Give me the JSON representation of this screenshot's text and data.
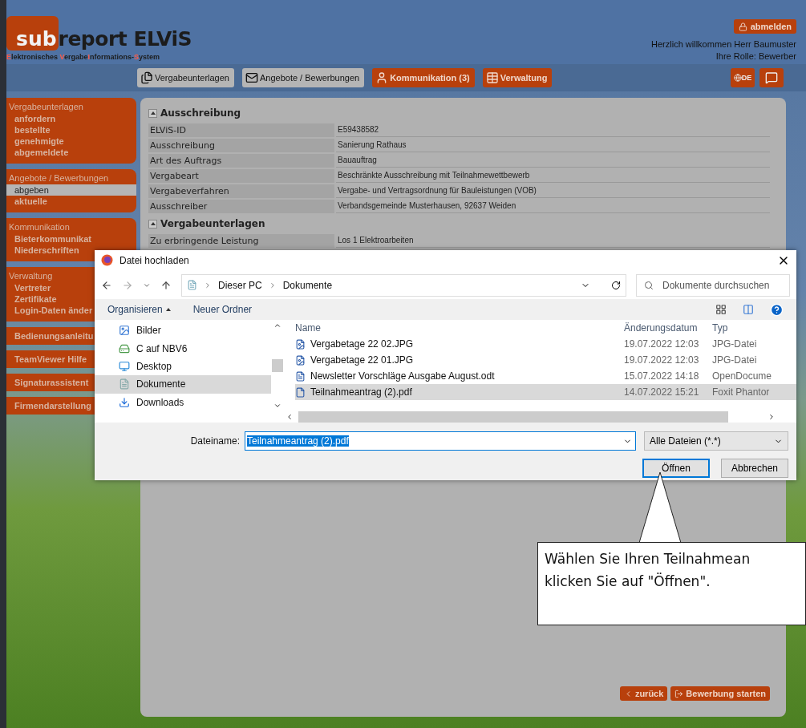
{
  "header": {
    "logo": {
      "part_1": "sub",
      "part_2": "report ELViS"
    },
    "subtitle": [
      {
        "text": "E",
        "accent": true
      },
      {
        "text": "lektronisches ",
        "accent": false
      },
      {
        "text": "V",
        "accent": true
      },
      {
        "text": "ergabe",
        "accent": false
      },
      {
        "text": "I",
        "accent": true
      },
      {
        "text": "nformations-",
        "accent": false
      },
      {
        "text": "S",
        "accent": true
      },
      {
        "text": "ystem",
        "accent": false
      }
    ],
    "logout": "abmelden",
    "welcome": "Herzlich willkommen Herr Baumuster",
    "role": "Ihre Rolle: Bewerber"
  },
  "nav": {
    "tabs": [
      {
        "label": "Vergabeunterlagen",
        "selected": true
      },
      {
        "label": "Angebote / Bewerbungen",
        "selected": true
      },
      {
        "label": "Kommunikation (3)",
        "selected": false
      },
      {
        "label": "Verwaltung",
        "selected": false
      }
    ],
    "language": "DE"
  },
  "sidebar": [
    {
      "title": "Vergabeunterlagen",
      "items": [
        {
          "label": "anfordern",
          "selected": false
        },
        {
          "label": "bestellte",
          "selected": false
        },
        {
          "label": "genehmigte",
          "selected": false
        },
        {
          "label": "abgemeldete",
          "selected": false
        }
      ]
    },
    {
      "title": "Angebote / Bewerbungen",
      "items": [
        {
          "label": "abgeben",
          "selected": true
        },
        {
          "label": "aktuelle",
          "selected": false
        }
      ]
    },
    {
      "title": "Kommunikation",
      "items": [
        {
          "label": "Bieterkommunikat",
          "selected": false
        },
        {
          "label": "Niederschriften",
          "selected": false
        }
      ]
    },
    {
      "title": "Verwaltung",
      "items": [
        {
          "label": "Vertreter",
          "selected": false
        },
        {
          "label": "Zertifikate",
          "selected": false
        },
        {
          "label": "Login-Daten änder",
          "selected": false
        }
      ]
    },
    {
      "title": "Bedienungsanleitu"
    },
    {
      "title": "TeamViewer Hilfe"
    },
    {
      "title": "Signaturassistent"
    },
    {
      "title": "Firmendarstellung"
    }
  ],
  "main": {
    "sections": [
      {
        "title": "Ausschreibung",
        "rows": [
          {
            "label": "ELViS-ID",
            "value": "E59438582"
          },
          {
            "label": "Ausschreibung",
            "value": "Sanierung Rathaus"
          },
          {
            "label": "Art des Auftrags",
            "value": "Bauauftrag"
          },
          {
            "label": "Vergabeart",
            "value": "Beschränkte Ausschreibung mit Teilnahmewettbewerb"
          },
          {
            "label": "Vergabeverfahren",
            "value": "Vergabe- und Vertragsordnung für Bauleistungen (VOB)"
          },
          {
            "label": "Ausschreiber",
            "value": "Verbandsgemeinde Musterhausen, 92637 Weiden"
          }
        ]
      },
      {
        "title": "Vergabeunterlagen",
        "rows": [
          {
            "label": "Zu erbringende Leistung",
            "value": "Los 1 Elektroarbeiten"
          }
        ]
      }
    ],
    "buttons": [
      {
        "kind": "back",
        "label": "zurück"
      },
      {
        "kind": "start",
        "label": "Bewerbung starten"
      }
    ]
  },
  "dialog": {
    "title": "Datei hochladen",
    "path": [
      "Dieser PC",
      "Dokumente"
    ],
    "search": {
      "placeholder": "Dokumente durchsuchen"
    },
    "toolbar": {
      "organize": "Organisieren",
      "new_folder": "Neuer Ordner"
    },
    "tree": [
      {
        "kind": "pictures",
        "label": "Bilder",
        "selected": false
      },
      {
        "kind": "drive",
        "label": "C auf NBV6",
        "selected": false
      },
      {
        "kind": "desktop",
        "label": "Desktop",
        "selected": false
      },
      {
        "kind": "documents",
        "label": "Dokumente",
        "selected": true
      },
      {
        "kind": "downloads",
        "label": "Downloads",
        "selected": false
      }
    ],
    "columns": [
      "Name",
      "Änderungsdatum",
      "Typ"
    ],
    "files": [
      {
        "kind": "image",
        "name": "Vergabetage 22 02.JPG",
        "date": "19.07.2022 12:03",
        "type": "JPG-Datei",
        "selected": false
      },
      {
        "kind": "image",
        "name": "Vergabetage 22 01.JPG",
        "date": "19.07.2022 12:03",
        "type": "JPG-Datei",
        "selected": false
      },
      {
        "kind": "document",
        "name": "Newsletter Vorschläge Ausgabe August.odt",
        "date": "15.07.2022 14:18",
        "type": "OpenDocume",
        "selected": false
      },
      {
        "kind": "pdf",
        "name": "Teilnahmeantrag (2).pdf",
        "date": "14.07.2022 15:21",
        "type": "Foxit Phantor",
        "selected": true
      }
    ],
    "filename_label": "Dateiname:",
    "filename": "Teilnahmeantrag (2).pdf",
    "filter": "Alle Dateien (*.*)",
    "open": "Öffnen",
    "cancel": "Abbrechen"
  },
  "callout": {
    "lines": [
      "Wählen Sie Ihren Teilnahmean",
      "klicken Sie auf \"Öffnen\"."
    ]
  }
}
